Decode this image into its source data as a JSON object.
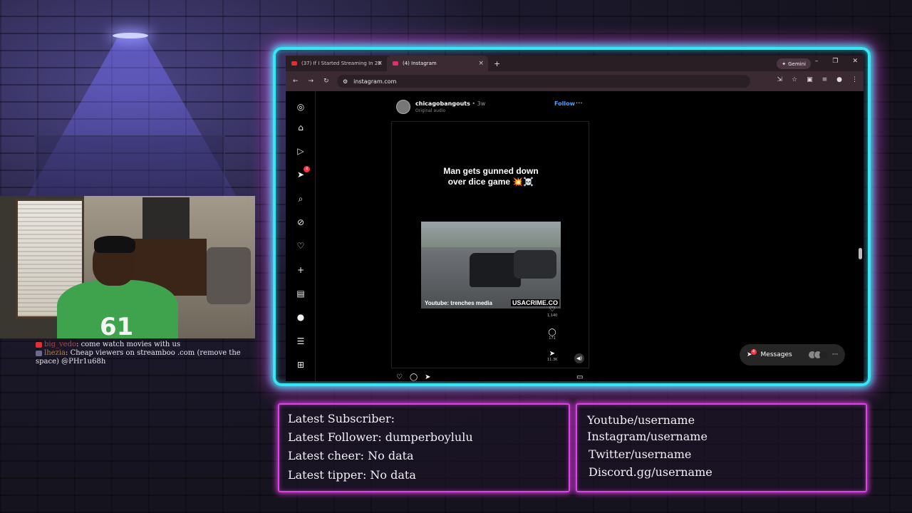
{
  "browser": {
    "tabs": [
      {
        "label": "(37) If I Started Streaming In 20",
        "favicon": "youtube-icon",
        "color": "#e03030"
      },
      {
        "label": "(4) Instagram",
        "favicon": "instagram-icon",
        "color": "#e1306c"
      }
    ],
    "gemini_label": "Gemini",
    "url": "instagram.com"
  },
  "instagram": {
    "nav_badge": "4",
    "post": {
      "username": "chicagobangouts",
      "age": " • 3w",
      "audio": "Original audio",
      "follow_label": "Follow",
      "reel_title_line1": "Man gets gunned down",
      "reel_title_line2": "over dice game 💥☠️",
      "clip_caption_left": "Youtube: trenches media",
      "clip_caption_right": "USACRIME.CO",
      "likes": "1,140",
      "comments": "171",
      "shares": "11.3K"
    },
    "messages": {
      "label": "Messages",
      "badge": "4"
    }
  },
  "chat": [
    {
      "user": "big_vedo",
      "message": "come watch movies with us"
    },
    {
      "user": "lhezia",
      "message": "Cheap viewers on streamboo .com (remove the space) @PHr1u68h"
    }
  ],
  "panels": {
    "left": [
      "Latest Subscriber:",
      "Latest Follower: dumperboylulu",
      "Latest cheer: No data",
      "Latest tipper: No data"
    ],
    "right": [
      "Youtube/username",
      "Instagram/username",
      "Twitter/username",
      "Discord.gg/username"
    ]
  },
  "colors": {
    "neon_cyan": "#36e6f2",
    "neon_magenta": "#e040e8",
    "ig_link": "#4aa3ff"
  }
}
